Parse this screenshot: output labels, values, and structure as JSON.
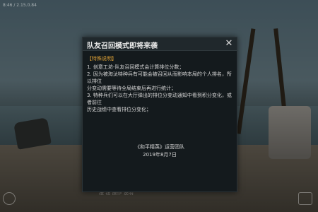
{
  "hud": {
    "top_left": "8:46 / 2.15.0.84",
    "bottom_text": "按 钮 操作 说明"
  },
  "dialog": {
    "title": "队友召回模式即将来袭",
    "close_icon": "close-icon",
    "section_heading": "【特殊说明】",
    "rules": [
      "1. 创意工坊-队友召回模式会计算排位分数；",
      "2. 因为被淘汰特种兵有可能会被召回从而影响本局的个人排名，所以排位",
      "分变动需要等待全局结束后再进行统计；",
      "3. 特种兵们可以在大厅弹出的排位分变动通知中看到积分变化，或者前往",
      "历史战绩中查看排位分变化；"
    ],
    "signature_team": "《和平精英》运营团队",
    "signature_date": "2019年8月7日"
  },
  "colors": {
    "heading_accent": "#e2a436",
    "dialog_bg": "#141a1d"
  }
}
